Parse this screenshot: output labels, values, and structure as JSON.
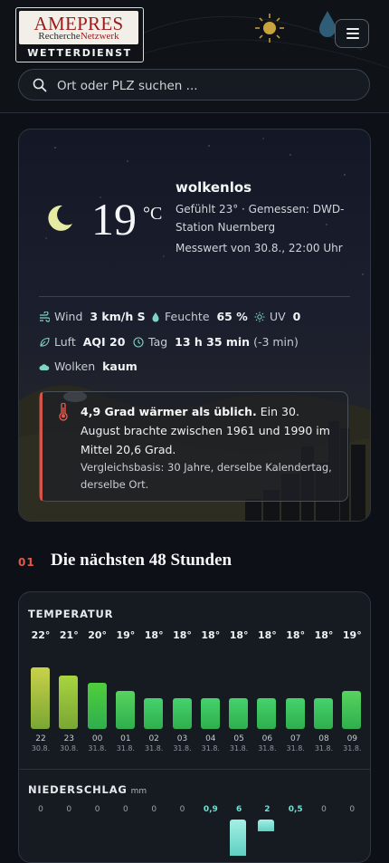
{
  "header": {
    "logo": {
      "word": "AMEPRES",
      "sub_left": "Recherche",
      "sub_right": "Netzwerk",
      "tagline": "WETTERDIENST"
    },
    "menu_icon": "hamburger-icon",
    "search": {
      "placeholder": "Ort oder PLZ suchen ...",
      "value": ""
    }
  },
  "current": {
    "icon": "crescent-moon-icon",
    "temperature": "19",
    "unit": "°C",
    "condition": "wolkenlos",
    "felt_line": "Gefühlt 23° · Gemessen: DWD-Station Nuernberg",
    "measured_line": "Messwert von 30.8., 22:00 Uhr",
    "stats": {
      "wind": {
        "label": "Wind",
        "value": "3 km/h S"
      },
      "humidity": {
        "label": "Feuchte",
        "value": "65 %"
      },
      "uv": {
        "label": "UV",
        "value": "0"
      },
      "air": {
        "label": "Luft",
        "value": "AQI 20"
      },
      "day": {
        "label": "Tag",
        "value": "13 h 35 min",
        "delta": "(-3 min)"
      },
      "clouds": {
        "label": "Wolken",
        "value": "kaum"
      }
    },
    "anomaly": {
      "bold": "4,9 Grad wärmer als üblich.",
      "text": " Ein 30. August brachte zwischen 1961 und 1990 im Mittel 20,6 Grad.",
      "basis": "Vergleichsbasis: 30 Jahre, derselbe Kalendertag, derselbe Ort.",
      "accent": "#d2554a"
    }
  },
  "forecast": {
    "section_number": "01",
    "section_title": "Die nächsten 48 Stunden",
    "temperature_label": "TEMPERATUR",
    "precip_label": "NIEDERSCHLAG",
    "precip_unit": "mm",
    "hours": [
      {
        "temp": "22°",
        "t": 22,
        "hour": "22",
        "date": "30.8.",
        "precip": "0",
        "p": 0
      },
      {
        "temp": "21°",
        "t": 21,
        "hour": "23",
        "date": "30.8.",
        "precip": "0",
        "p": 0
      },
      {
        "temp": "20°",
        "t": 20,
        "hour": "00",
        "date": "31.8.",
        "precip": "0",
        "p": 0
      },
      {
        "temp": "19°",
        "t": 19,
        "hour": "01",
        "date": "31.8.",
        "precip": "0",
        "p": 0
      },
      {
        "temp": "18°",
        "t": 18,
        "hour": "02",
        "date": "31.8.",
        "precip": "0",
        "p": 0
      },
      {
        "temp": "18°",
        "t": 18,
        "hour": "03",
        "date": "31.8.",
        "precip": "0",
        "p": 0
      },
      {
        "temp": "18°",
        "t": 18,
        "hour": "04",
        "date": "31.8.",
        "precip": "0,9",
        "p": 0.9
      },
      {
        "temp": "18°",
        "t": 18,
        "hour": "05",
        "date": "31.8.",
        "precip": "6",
        "p": 6
      },
      {
        "temp": "18°",
        "t": 18,
        "hour": "06",
        "date": "31.8.",
        "precip": "2",
        "p": 2
      },
      {
        "temp": "18°",
        "t": 18,
        "hour": "07",
        "date": "31.8.",
        "precip": "0,5",
        "p": 0.5
      },
      {
        "temp": "18°",
        "t": 18,
        "hour": "08",
        "date": "31.8.",
        "precip": "0",
        "p": 0
      },
      {
        "temp": "19°",
        "t": 19,
        "hour": "09",
        "date": "31.8.",
        "precip": "0",
        "p": 0
      }
    ]
  }
}
